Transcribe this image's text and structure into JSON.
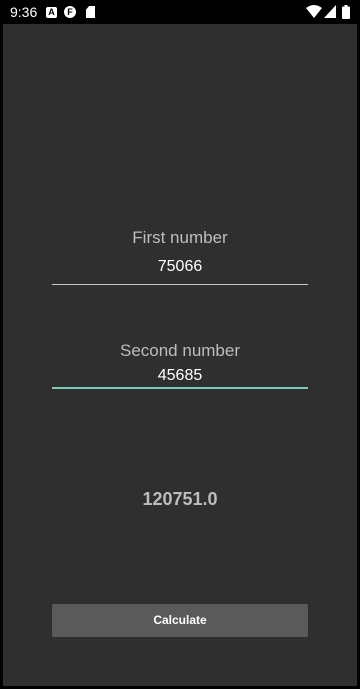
{
  "status_bar": {
    "time": "9:36",
    "notification_icons": [
      "a-notification-icon",
      "f-notification-icon",
      "sd-card-icon"
    ],
    "notification_a_glyph": "A",
    "notification_f_glyph": "F",
    "system_icons": [
      "wifi-icon",
      "cell-signal-icon",
      "battery-icon"
    ]
  },
  "form": {
    "first_label": "First number",
    "first_value": "75066",
    "second_label": "Second number",
    "second_value": "45685",
    "result": "120751.0",
    "calculate_label": "Calculate"
  },
  "colors": {
    "background": "#2f2f2f",
    "focus_underline": "#7cc8b6",
    "button": "#5a5a5a"
  }
}
